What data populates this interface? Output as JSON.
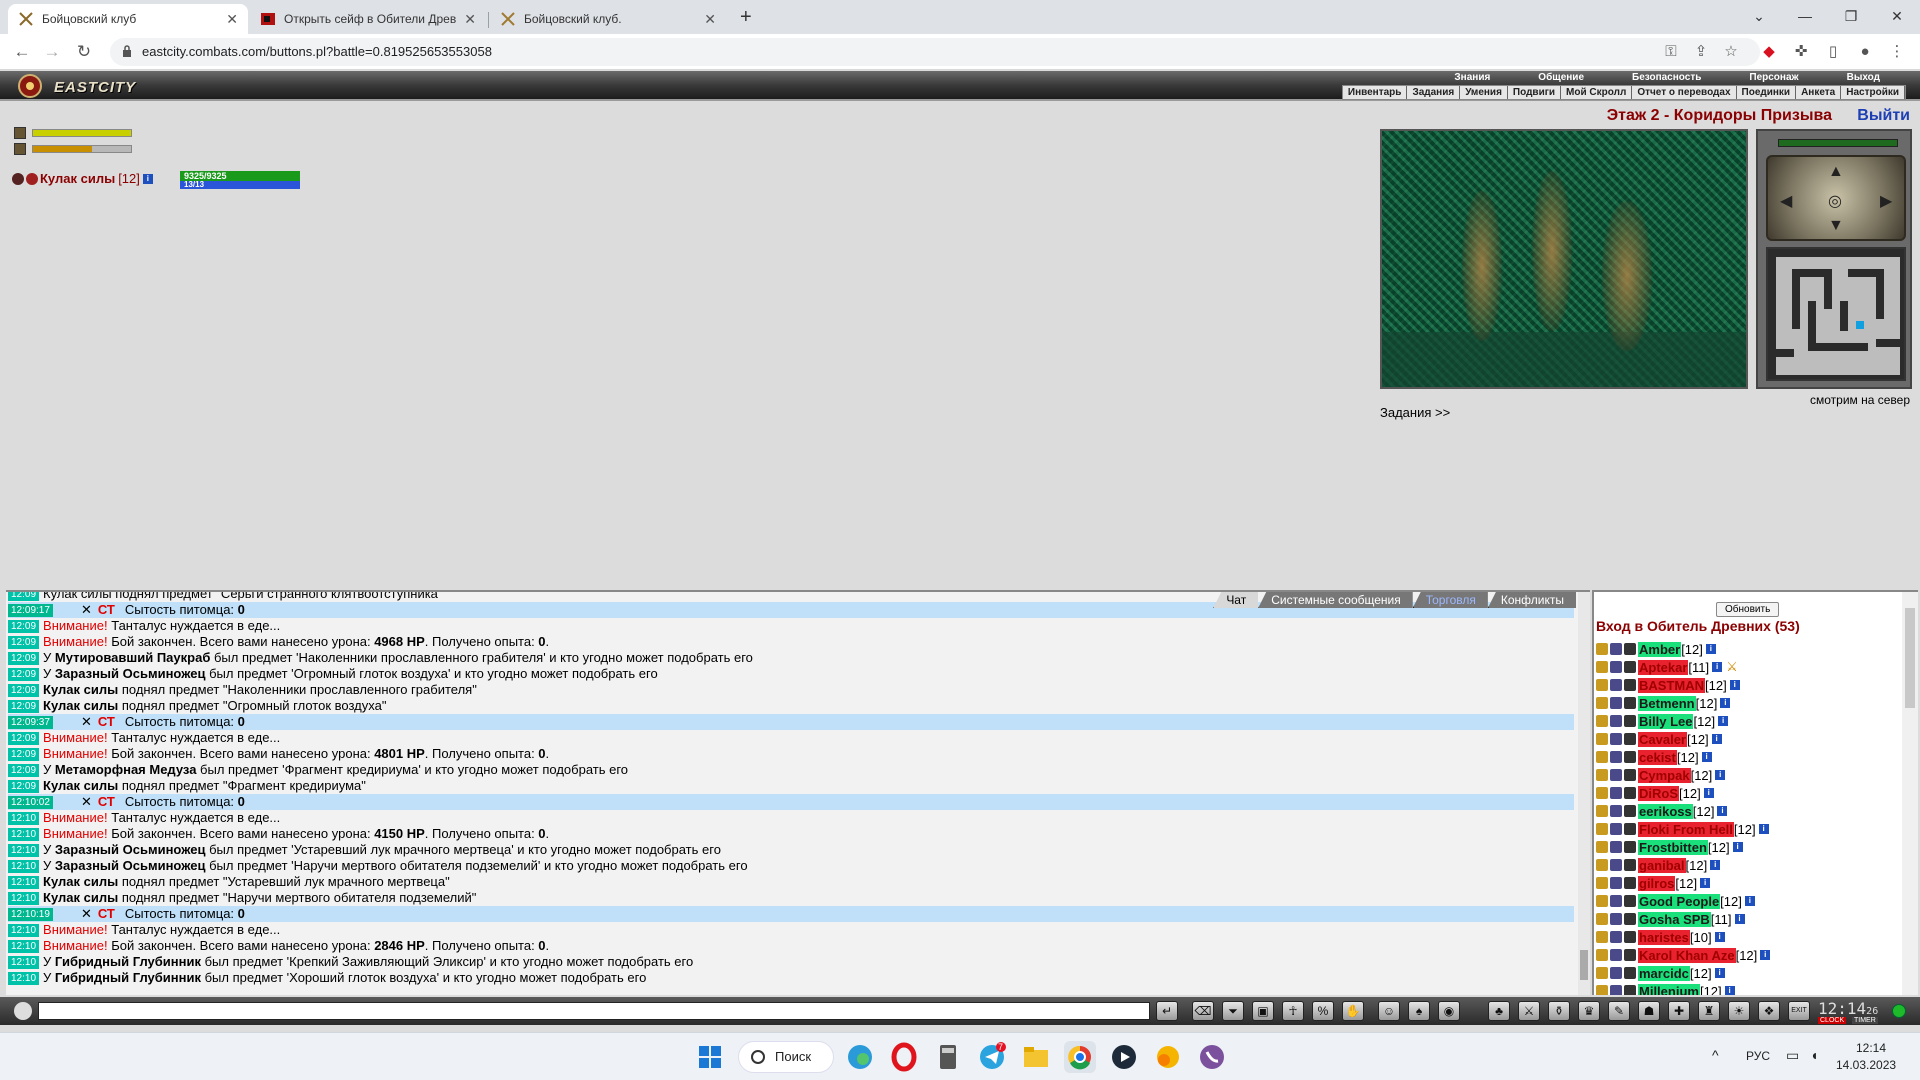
{
  "browser": {
    "tabs": [
      {
        "title": "Бойцовский клуб",
        "active": true
      },
      {
        "title": "Открыть сейф в Обители Древн",
        "active": false
      },
      {
        "title": "Бойцовский клуб.",
        "active": false
      }
    ],
    "url": "eastcity.combats.com/buttons.pl?battle=0.819525653553058"
  },
  "game": {
    "logo": "EASTCITY",
    "top_menu": [
      "Знания",
      "Общение",
      "Безопасность",
      "Персонаж",
      "Выход"
    ],
    "sub_menu": [
      "Инвентарь",
      "Задания",
      "Умения",
      "Подвиги",
      "Мой Скролл",
      "Отчет о переводах",
      "Поединки",
      "Анкета",
      "Настройки"
    ],
    "location_title": "Этаж 2 - Коридоры Призыва",
    "exit_label": "Выйти",
    "look_direction": "смотрим на север",
    "tasks_link": "Задания >>",
    "bars": [
      {
        "value": 1.0,
        "color": "#c8d000"
      },
      {
        "value": 0.6,
        "color": "#c89000"
      }
    ],
    "player": {
      "name": "Кулак силы",
      "level": "[12]",
      "info_icon": "i",
      "hp_text": "9325/9325",
      "hp_fraction": 1.0,
      "mp_text": "13/13",
      "mp_fraction": 1.0
    }
  },
  "chat": {
    "tabs": [
      "Чат",
      "Системные сообщения",
      "Торговля",
      "Конфликты"
    ],
    "partial_top": "Кулак силы поднял предмет \"Серьги странного клятвоотступника\"",
    "lines": [
      {
        "type": "sys",
        "time": "12:09:17",
        "x": "✕",
        "ct": "СТ",
        "text": "Сытость питомца: ",
        "bold": "0"
      },
      {
        "type": "warn",
        "time": "12:09",
        "warn": "Внимание!",
        "text": " Танталус нуждается в еде..."
      },
      {
        "type": "battle",
        "time": "12:09",
        "warn": "Внимание!",
        "text": " Бой закончен. Всего вами нанесено урона: ",
        "dmg": "4968 HP",
        "mid": ". Получено опыта: ",
        "exp": "0",
        "end": "."
      },
      {
        "type": "drop",
        "time": "12:09",
        "pre": "У ",
        "who": "Мутировавший Паукраб",
        "text": " был предмет 'Наколенники прославленного грабителя' и кто угодно может подобрать его"
      },
      {
        "type": "drop",
        "time": "12:09",
        "pre": "У ",
        "who": "Заразный Осьминожец",
        "text": " был предмет 'Огромный глоток воздуха' и кто угодно может подобрать его"
      },
      {
        "type": "pick",
        "time": "12:09",
        "who": "Кулак силы",
        "text": " поднял предмет \"Наколенники прославленного грабителя\""
      },
      {
        "type": "pick",
        "time": "12:09",
        "who": "Кулак силы",
        "text": " поднял предмет \"Огромный глоток воздуха\""
      },
      {
        "type": "sys",
        "time": "12:09:37",
        "x": "✕",
        "ct": "СТ",
        "text": "Сытость питомца: ",
        "bold": "0"
      },
      {
        "type": "warn",
        "time": "12:09",
        "warn": "Внимание!",
        "text": " Танталус нуждается в еде..."
      },
      {
        "type": "battle",
        "time": "12:09",
        "warn": "Внимание!",
        "text": " Бой закончен. Всего вами нанесено урона: ",
        "dmg": "4801 HP",
        "mid": ". Получено опыта: ",
        "exp": "0",
        "end": "."
      },
      {
        "type": "drop",
        "time": "12:09",
        "pre": "У ",
        "who": "Метаморфная Медуза",
        "text": " был предмет 'Фрагмент кредириума' и кто угодно может подобрать его"
      },
      {
        "type": "pick",
        "time": "12:09",
        "who": "Кулак силы",
        "text": " поднял предмет \"Фрагмент кредириума\""
      },
      {
        "type": "sys",
        "time": "12:10:02",
        "x": "✕",
        "ct": "СТ",
        "text": "Сытость питомца: ",
        "bold": "0"
      },
      {
        "type": "warn",
        "time": "12:10",
        "warn": "Внимание!",
        "text": " Танталус нуждается в еде..."
      },
      {
        "type": "battle",
        "time": "12:10",
        "warn": "Внимание!",
        "text": " Бой закончен. Всего вами нанесено урона: ",
        "dmg": "4150 HP",
        "mid": ". Получено опыта: ",
        "exp": "0",
        "end": "."
      },
      {
        "type": "drop",
        "time": "12:10",
        "pre": "У ",
        "who": "Заразный Осьминожец",
        "text": " был предмет 'Устаревший лук мрачного мертвеца' и кто угодно может подобрать его"
      },
      {
        "type": "drop",
        "time": "12:10",
        "pre": "У ",
        "who": "Заразный Осьминожец",
        "text": " был предмет 'Наручи мертвого обитателя подземелий' и кто угодно может подобрать его"
      },
      {
        "type": "pick",
        "time": "12:10",
        "who": "Кулак силы",
        "text": " поднял предмет \"Устаревший лук мрачного мертвеца\""
      },
      {
        "type": "pick",
        "time": "12:10",
        "who": "Кулак силы",
        "text": " поднял предмет \"Наручи мертвого обитателя подземелий\""
      },
      {
        "type": "sys",
        "time": "12:10:19",
        "x": "✕",
        "ct": "СТ",
        "text": "Сытость питомца: ",
        "bold": "0"
      },
      {
        "type": "warn",
        "time": "12:10",
        "warn": "Внимание!",
        "text": " Танталус нуждается в еде..."
      },
      {
        "type": "battle",
        "time": "12:10",
        "warn": "Внимание!",
        "text": " Бой закончен. Всего вами нанесено урона: ",
        "dmg": "2846 HP",
        "mid": ". Получено опыта: ",
        "exp": "0",
        "end": "."
      },
      {
        "type": "drop",
        "time": "12:10",
        "pre": "У ",
        "who": "Гибридный Глубинник",
        "text": " был предмет 'Крепкий Заживляющий Эликсир' и кто угодно может подобрать его"
      },
      {
        "type": "drop",
        "time": "12:10",
        "pre": "У ",
        "who": "Гибридный Глубинник",
        "text": " был предмет 'Хороший глоток воздуха' и кто угодно может подобрать его"
      }
    ]
  },
  "online": {
    "refresh_label": "Обновить",
    "title": "Вход в Обитель Древних (53)",
    "users": [
      {
        "name": "Amber",
        "level": "[12]",
        "color": "g"
      },
      {
        "name": "Aptekar",
        "level": "[11]",
        "color": "r",
        "extra": "⚔"
      },
      {
        "name": "BASTMAN",
        "level": "[12]",
        "color": "r"
      },
      {
        "name": "Betmenn",
        "level": "[12]",
        "color": "g"
      },
      {
        "name": "Billy Lee",
        "level": "[12]",
        "color": "g"
      },
      {
        "name": "Cavaler",
        "level": "[12]",
        "color": "r"
      },
      {
        "name": "cekist",
        "level": "[12]",
        "color": "r"
      },
      {
        "name": "Cympak",
        "level": "[12]",
        "color": "r"
      },
      {
        "name": "DiRoS",
        "level": "[12]",
        "color": "r"
      },
      {
        "name": "eerikoss",
        "level": "[12]",
        "color": "g"
      },
      {
        "name": "Floki From Hell",
        "level": "[12]",
        "color": "r"
      },
      {
        "name": "Frostbitten",
        "level": "[12]",
        "color": "g"
      },
      {
        "name": "ganibal",
        "level": "[12]",
        "color": "r"
      },
      {
        "name": "gilros",
        "level": "[12]",
        "color": "r"
      },
      {
        "name": "Good People",
        "level": "[12]",
        "color": "g"
      },
      {
        "name": "Gosha SPB",
        "level": "[11]",
        "color": "g"
      },
      {
        "name": "haristes",
        "level": "[10]",
        "color": "r"
      },
      {
        "name": "Karol Khan Aze",
        "level": "[12]",
        "color": "r"
      },
      {
        "name": "marcidc",
        "level": "[12]",
        "color": "g"
      },
      {
        "name": "Millenium",
        "level": "[12]",
        "color": "g"
      }
    ]
  },
  "inbar": {
    "clock": "12:14",
    "clock_sec": "26",
    "clock_label": "CLOCK",
    "timer_label": "TIMER",
    "exit_label": "EXIT"
  },
  "taskbar": {
    "search_label": "Поиск",
    "lang": "РУС",
    "time": "12:14",
    "date": "14.03.2023",
    "badge": "7"
  }
}
